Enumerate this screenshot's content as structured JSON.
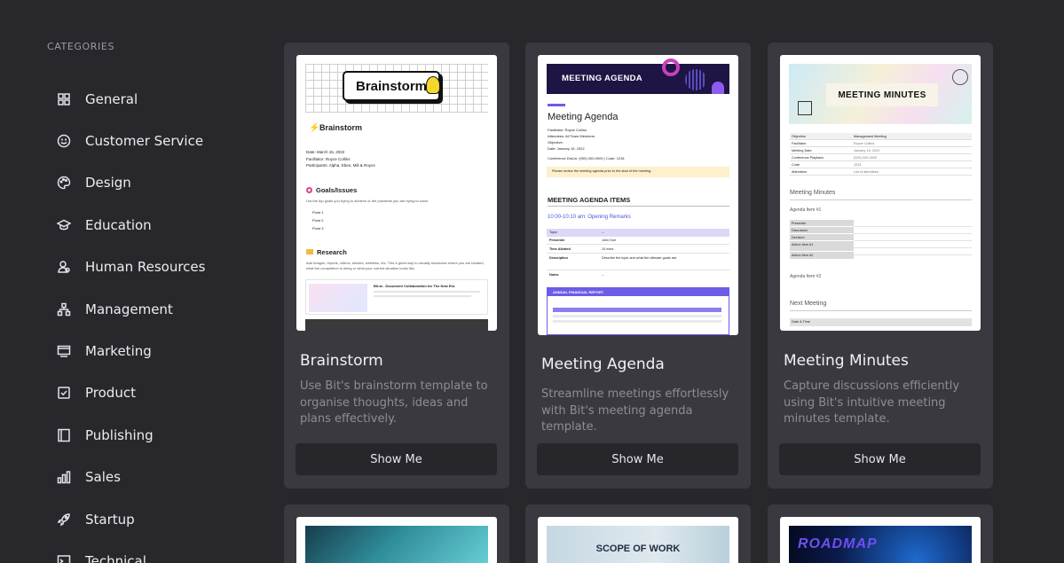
{
  "sidebar": {
    "heading": "CATEGORIES",
    "items": [
      {
        "label": "General",
        "icon": "grid-icon"
      },
      {
        "label": "Customer Service",
        "icon": "smile-icon"
      },
      {
        "label": "Design",
        "icon": "palette-icon"
      },
      {
        "label": "Education",
        "icon": "graduation-cap-icon"
      },
      {
        "label": "Human Resources",
        "icon": "people-icon"
      },
      {
        "label": "Management",
        "icon": "org-chart-icon"
      },
      {
        "label": "Marketing",
        "icon": "monitor-icon"
      },
      {
        "label": "Product",
        "icon": "checkbox-icon"
      },
      {
        "label": "Publishing",
        "icon": "book-icon"
      },
      {
        "label": "Sales",
        "icon": "bar-chart-icon"
      },
      {
        "label": "Startup",
        "icon": "rocket-icon"
      },
      {
        "label": "Technical",
        "icon": "terminal-icon"
      }
    ]
  },
  "cards": [
    {
      "title": "Brainstorm",
      "description": "Use Bit's brainstorm template to organise thoughts, ideas and plans effectively.",
      "button": "Show Me",
      "thumb": {
        "banner": "Brainstorm",
        "heading": "Brainstorm",
        "meta1": "Date: March 15, 2022",
        "meta2": "Facilitator: Royce Collins",
        "meta3": "Participants: Alpha, Eben, Mili & Royce",
        "section1": "Goals/Issues",
        "section1_text": "List the top goals you trying to achieve or the problems you are trying to solve.",
        "points": [
          "Point 1",
          "Point 2",
          "Point 3"
        ],
        "section2": "Research",
        "section2_text": "Add images, reports, videos, articles, weblinks, etc. This a great way to visually showcase where you are headed, what the competition is doing or what your current situation looks like.",
        "embed_title": "Bit.ai - Document Collaboration for The New Era"
      }
    },
    {
      "title": "Meeting Agenda",
      "description": "Streamline meetings effortlessly with Bit's meeting agenda template.",
      "button": "Show Me",
      "thumb": {
        "banner": "MEETING AGENDA",
        "heading": "Meeting Agenda",
        "meta1": "Facilitator: Royce Collins",
        "meta2": "Attendees: All Team Members",
        "meta3": "Objective:",
        "meta4": "Date: January 15, 2022",
        "meta5": "Conference Dial-in: (000) 000-0000 | Code: 1234",
        "note": "Please review the meeting agenda prior to the start of the meeting.",
        "section": "MEETING AGENDA ITEMS",
        "time": "10:00-10:10 am: Opening Remarks",
        "rows": [
          "Topic",
          "Presenter",
          "Time Allotted",
          "Description",
          "Notes"
        ],
        "values": [
          "--",
          "John Doe",
          "10 mins",
          "Describe the topic and what the ultimate goals are.",
          "--"
        ],
        "report": "ANNUAL FINANCIAL REPORT"
      }
    },
    {
      "title": "Meeting Minutes",
      "description": "Capture discussions efficiently using Bit's intuitive meeting minutes template.",
      "button": "Show Me",
      "thumb": {
        "banner": "MEETING MINUTES",
        "rows": [
          "Objective",
          "Facilitator",
          "Meeting Date",
          "Conference Playback",
          "Code",
          "Attendees"
        ],
        "values": [
          "Management Meeting",
          "Royce Collins",
          "January 15, 2022",
          "(000) 000-0000",
          "1234",
          "List of attendees"
        ],
        "section1": "Meeting Minutes",
        "item1": "Agenda Item #1",
        "subrows": [
          "Presenter",
          "Discussion",
          "Decision",
          "Action Item #1",
          "Action Item #2"
        ],
        "item2": "Agenda Item #2",
        "section2": "Next Meeting",
        "next_row": "Date & Time"
      }
    }
  ],
  "bottom_cards": [
    {
      "label": ""
    },
    {
      "label": "SCOPE OF WORK"
    },
    {
      "label": "ROADMAP"
    }
  ],
  "colors": {
    "background": "#27272c",
    "card": "#39393f",
    "button": "#26262b",
    "accent_purple": "#6c5ce7"
  }
}
